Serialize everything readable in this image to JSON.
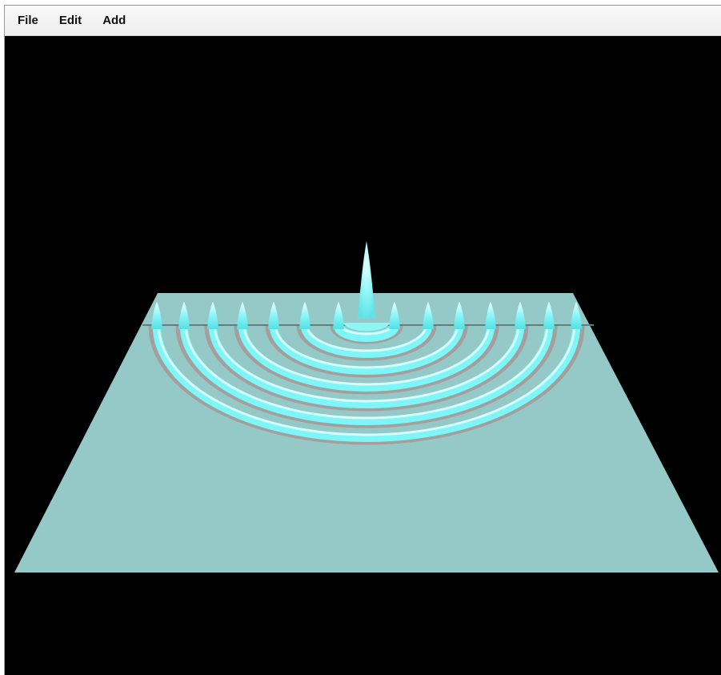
{
  "menubar": {
    "items": [
      {
        "label": "File"
      },
      {
        "label": "Edit"
      },
      {
        "label": "Add"
      }
    ]
  },
  "scene": {
    "background_color": "#000000",
    "surface_color": "#94c9c8",
    "wave_color": "#6ef4f4",
    "trough_color": "#c98c8c"
  }
}
